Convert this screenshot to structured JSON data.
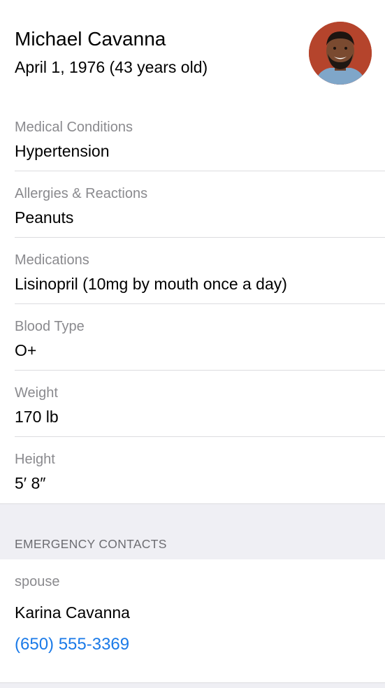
{
  "profile": {
    "name": "Michael Cavanna",
    "dob": "April 1, 1976 (43 years old)"
  },
  "fields": [
    {
      "label": "Medical Conditions",
      "value": "Hypertension"
    },
    {
      "label": "Allergies & Reactions",
      "value": "Peanuts"
    },
    {
      "label": "Medications",
      "value": "Lisinopril (10mg by mouth once a day)"
    },
    {
      "label": "Blood Type",
      "value": "O+"
    },
    {
      "label": "Weight",
      "value": "170 lb"
    },
    {
      "label": "Height",
      "value": "5′ 8″"
    }
  ],
  "emergency": {
    "section_title": "EMERGENCY CONTACTS",
    "contacts": [
      {
        "relation": "spouse",
        "name": "Karina Cavanna",
        "phone": "(650) 555-3369"
      }
    ]
  },
  "colors": {
    "link": "#1a7ae8",
    "secondary_text": "#8a8a8e",
    "grouped_background": "#efeff4"
  }
}
